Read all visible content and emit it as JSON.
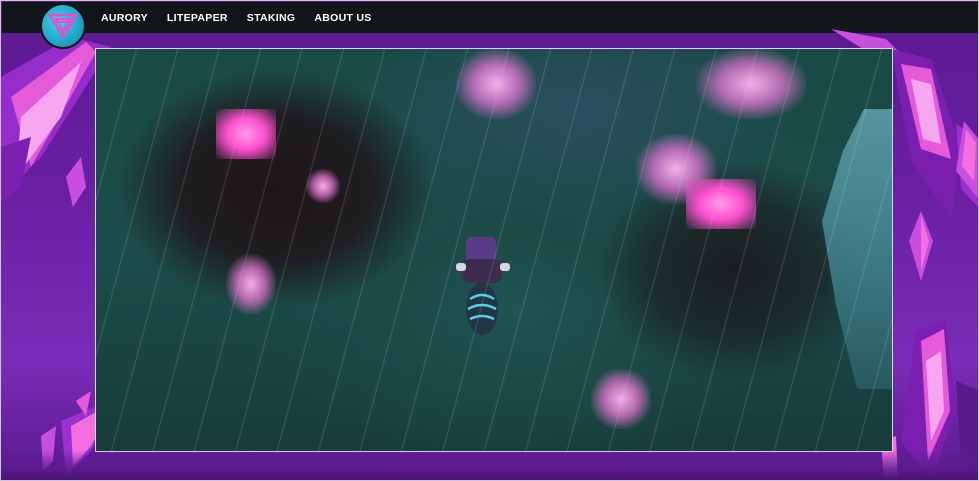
{
  "nav": {
    "logo_icon": "aurory-logo-icon",
    "links": [
      {
        "label": "AURORY"
      },
      {
        "label": "LITEPAPER"
      },
      {
        "label": "STAKING"
      },
      {
        "label": "ABOUT US"
      }
    ]
  },
  "hero": {
    "media": "game-trailer-video",
    "frame_border_color": "#d9d6e8",
    "background_color": "#6a1fa3",
    "accent_crystal_color": "#e94bd3"
  },
  "colors": {
    "navbar": "#111618",
    "logo_teal": "#2fbcd6",
    "crystal_pink": "#f36fe0",
    "purple_bg": "#6a1fa3"
  }
}
